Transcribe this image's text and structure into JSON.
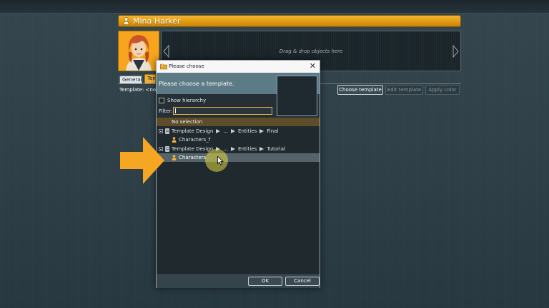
{
  "character": {
    "name": "Mina Harker",
    "drop_hint": "Drag & drop objects here"
  },
  "tabs": [
    {
      "label": "General"
    },
    {
      "label": "Template"
    }
  ],
  "template_row": {
    "label": "Template: <no t",
    "choose_button": "Choose template",
    "edit_button": "Edit template",
    "apply_button": "Apply color"
  },
  "dialog": {
    "title": "Please choose",
    "prompt": "Please choose a template.",
    "show_hierarchy_label": "Show hierarchy",
    "show_hierarchy_checked": false,
    "filter_label": "Filter:",
    "filter_value": "",
    "tree": {
      "no_selection": "No selection",
      "group1_path": [
        "Template Design",
        "...",
        "Entities",
        "Final"
      ],
      "group1_item": "Characters_f",
      "group2_path": [
        "Template Design",
        "...",
        "Entities",
        "Tutorial"
      ],
      "group2_item": "Characters"
    },
    "ok_label": "OK",
    "cancel_label": "Cancel"
  },
  "colors": {
    "accent_orange": "#f5a623",
    "selection": "#55646b",
    "highlight": "#e1d746"
  }
}
